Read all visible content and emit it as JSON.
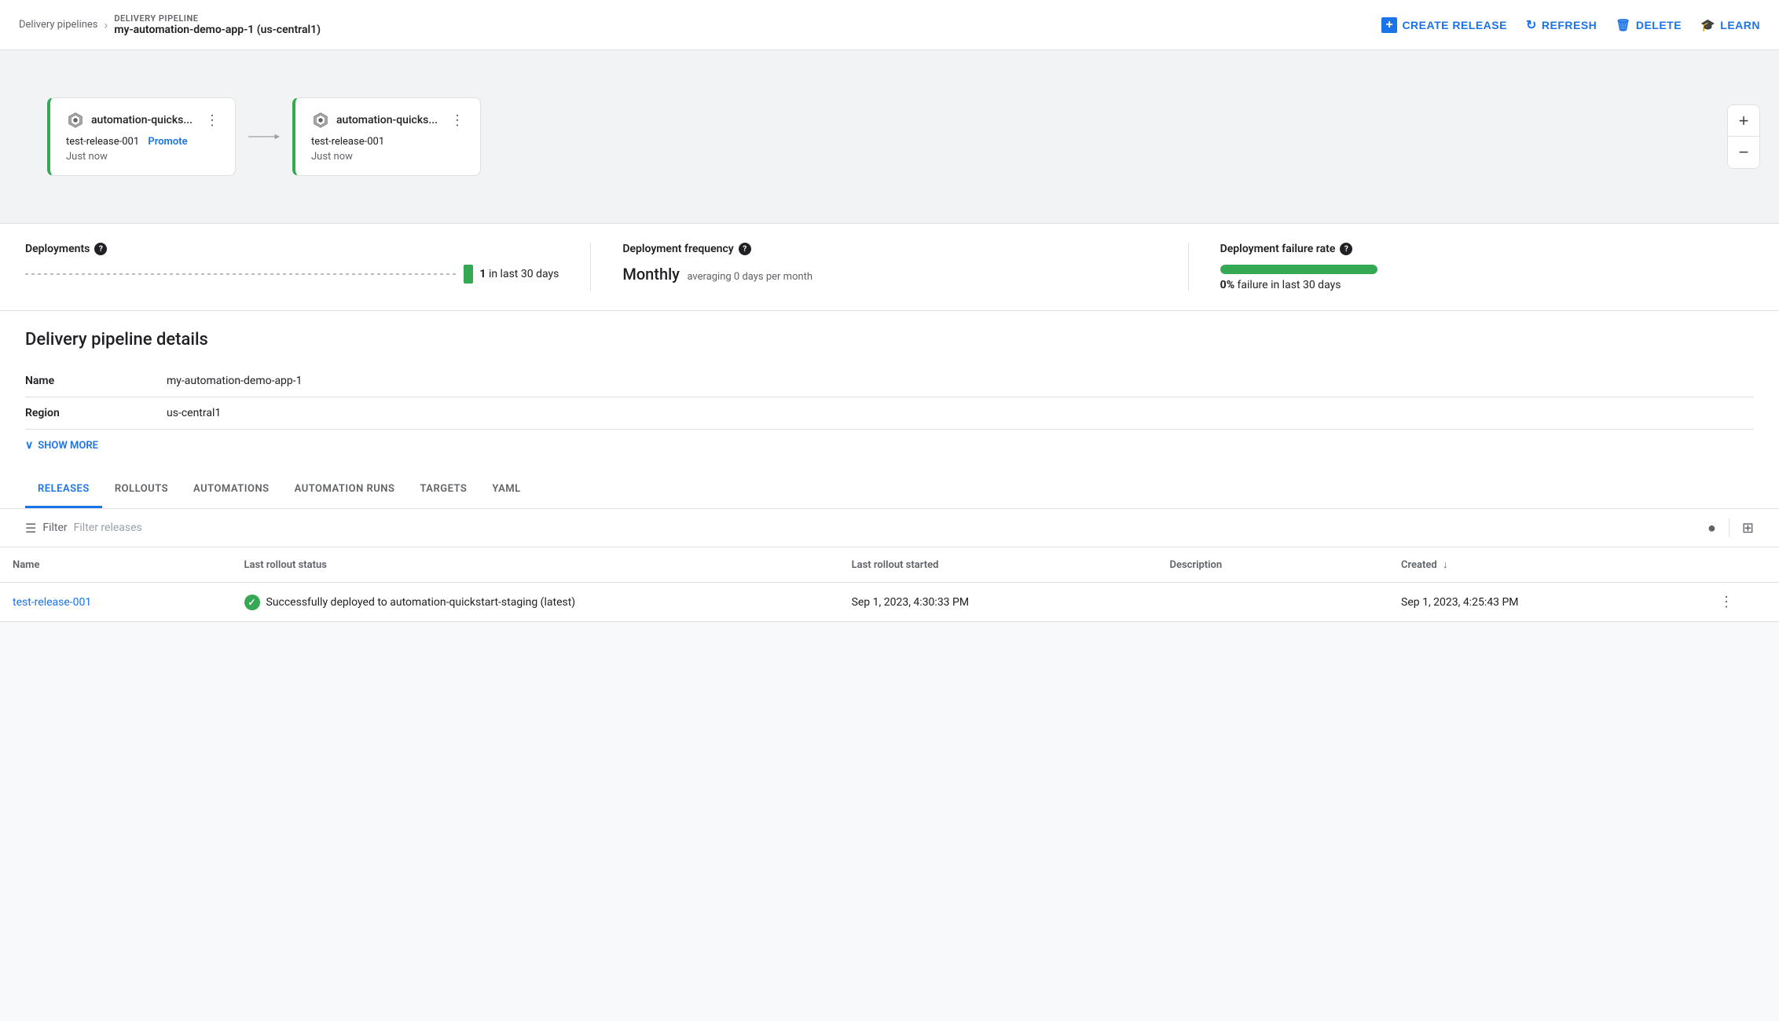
{
  "topbar": {
    "breadcrumb_link": "Delivery pipelines",
    "breadcrumb_current_label": "DELIVERY PIPELINE",
    "breadcrumb_current_sub": "my-automation-demo-app-1 (us-central1)",
    "create_release_label": "CREATE RELEASE",
    "refresh_label": "REFRESH",
    "delete_label": "DELETE",
    "learn_label": "LEARN"
  },
  "pipeline": {
    "nodes": [
      {
        "title": "automation-quicks...",
        "release": "test-release-001",
        "promote_label": "Promote",
        "time": "Just now"
      },
      {
        "title": "automation-quicks...",
        "release": "test-release-001",
        "promote_label": null,
        "time": "Just now"
      }
    ]
  },
  "stats": {
    "deployments_label": "Deployments",
    "deployments_count": "1",
    "deployments_suffix": "in last 30 days",
    "frequency_label": "Deployment frequency",
    "frequency_main": "Monthly",
    "frequency_sub": "averaging 0 days per month",
    "failure_label": "Deployment failure rate",
    "failure_bar_pct": 100,
    "failure_value": "0%",
    "failure_suffix": "failure",
    "failure_period": "in last 30 days"
  },
  "details": {
    "section_title": "Delivery pipeline details",
    "fields": [
      {
        "label": "Name",
        "value": "my-automation-demo-app-1"
      },
      {
        "label": "Region",
        "value": "us-central1"
      }
    ],
    "show_more_label": "SHOW MORE"
  },
  "tabs": [
    {
      "id": "releases",
      "label": "RELEASES",
      "active": true
    },
    {
      "id": "rollouts",
      "label": "ROLLOUTS",
      "active": false
    },
    {
      "id": "automations",
      "label": "AUTOMATIONS",
      "active": false
    },
    {
      "id": "automation_runs",
      "label": "AUTOMATION RUNS",
      "active": false
    },
    {
      "id": "targets",
      "label": "TARGETS",
      "active": false
    },
    {
      "id": "yaml",
      "label": "YAML",
      "active": false
    }
  ],
  "filter": {
    "label": "Filter",
    "placeholder": "Filter releases"
  },
  "table": {
    "columns": [
      {
        "id": "name",
        "label": "Name",
        "sortable": false
      },
      {
        "id": "status",
        "label": "Last rollout status",
        "sortable": false
      },
      {
        "id": "started",
        "label": "Last rollout started",
        "sortable": false
      },
      {
        "id": "description",
        "label": "Description",
        "sortable": false
      },
      {
        "id": "created",
        "label": "Created",
        "sortable": true,
        "sort_dir": "desc"
      }
    ],
    "rows": [
      {
        "name": "test-release-001",
        "status_text": "Successfully deployed to automation-quickstart-staging (latest)",
        "status_type": "success",
        "started": "Sep 1, 2023, 4:30:33 PM",
        "description": "",
        "created": "Sep 1, 2023, 4:25:43 PM"
      }
    ]
  },
  "zoom": {
    "plus_label": "+",
    "minus_label": "−"
  }
}
